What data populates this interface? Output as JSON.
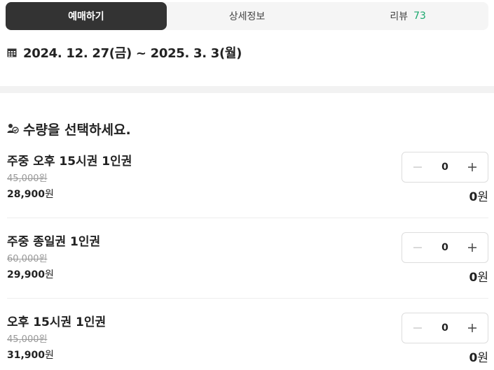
{
  "tabs": [
    {
      "label": "예매하기",
      "active": true
    },
    {
      "label": "상세정보",
      "active": false
    },
    {
      "label": "리뷰",
      "count": "73",
      "active": false
    }
  ],
  "period": {
    "icon": "calendar-icon",
    "text": "2024. 12. 27(금) ~ 2025. 3. 3(월)"
  },
  "quantity_section": {
    "icon": "people-icon",
    "title": "수량을 선택하세요."
  },
  "tickets": [
    {
      "name": "주중 오후 15시권 1인권",
      "original_price": "45,000원",
      "price": "28,900",
      "currency": "원",
      "quantity": "0",
      "subtotal": "0",
      "subtotal_unit": "원"
    },
    {
      "name": "주중 종일권 1인권",
      "original_price": "60,000원",
      "price": "29,900",
      "currency": "원",
      "quantity": "0",
      "subtotal": "0",
      "subtotal_unit": "원"
    },
    {
      "name": "오후 15시권 1인권",
      "original_price": "45,000원",
      "price": "31,900",
      "currency": "원",
      "quantity": "0",
      "subtotal": "0",
      "subtotal_unit": "원"
    }
  ],
  "colors": {
    "active_tab": "#333333",
    "review_count": "#1ba86e",
    "strike_price": "#999999"
  }
}
